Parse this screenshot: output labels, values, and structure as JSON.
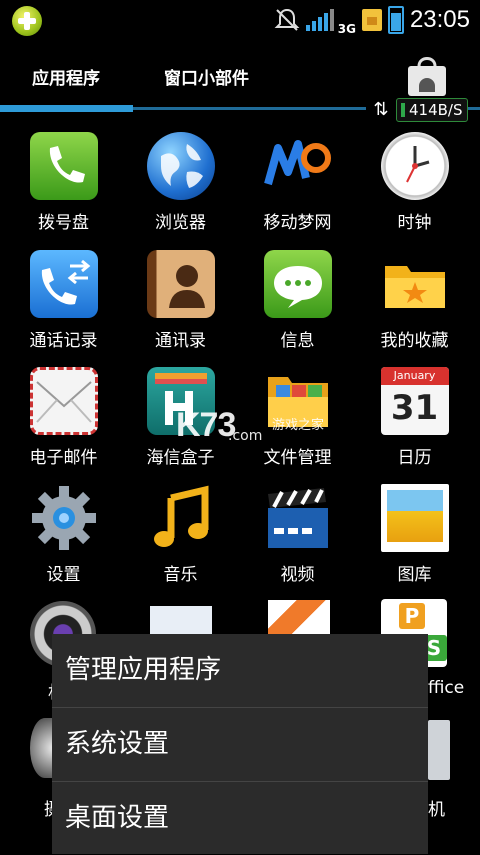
{
  "status_bar": {
    "time": "23:05",
    "network_type": "3G"
  },
  "tabs": [
    {
      "label": "应用程序",
      "selected": true
    },
    {
      "label": "窗口小部件",
      "selected": false
    }
  ],
  "speed_indicator": "414B/S",
  "apps": [
    {
      "label": "拨号盘",
      "icon": "phone-icon"
    },
    {
      "label": "浏览器",
      "icon": "globe-icon"
    },
    {
      "label": "移动梦网",
      "icon": "monternet-icon"
    },
    {
      "label": "时钟",
      "icon": "clock-icon"
    },
    {
      "label": "通话记录",
      "icon": "call-log-icon"
    },
    {
      "label": "通讯录",
      "icon": "contacts-icon"
    },
    {
      "label": "信息",
      "icon": "message-icon"
    },
    {
      "label": "我的收藏",
      "icon": "favorites-folder-icon"
    },
    {
      "label": "电子邮件",
      "icon": "envelope-icon"
    },
    {
      "label": "海信盒子",
      "icon": "hisense-box-icon"
    },
    {
      "label": "文件管理",
      "icon": "file-folder-icon"
    },
    {
      "label": "日历",
      "icon": "calendar-icon"
    },
    {
      "label": "设置",
      "icon": "gear-icon"
    },
    {
      "label": "音乐",
      "icon": "music-note-icon"
    },
    {
      "label": "视频",
      "icon": "clapperboard-icon"
    },
    {
      "label": "图库",
      "icon": "gallery-icon"
    }
  ],
  "calendar_icon": {
    "month": "January",
    "day": "31"
  },
  "partially_hidden_labels": [
    "相",
    "ffice",
    "摄",
    "机"
  ],
  "watermark": {
    "logo": "K73",
    "sub": "游戏之家",
    "domain": ".com"
  },
  "context_menu": {
    "items": [
      "管理应用程序",
      "系统设置",
      "桌面设置"
    ]
  }
}
